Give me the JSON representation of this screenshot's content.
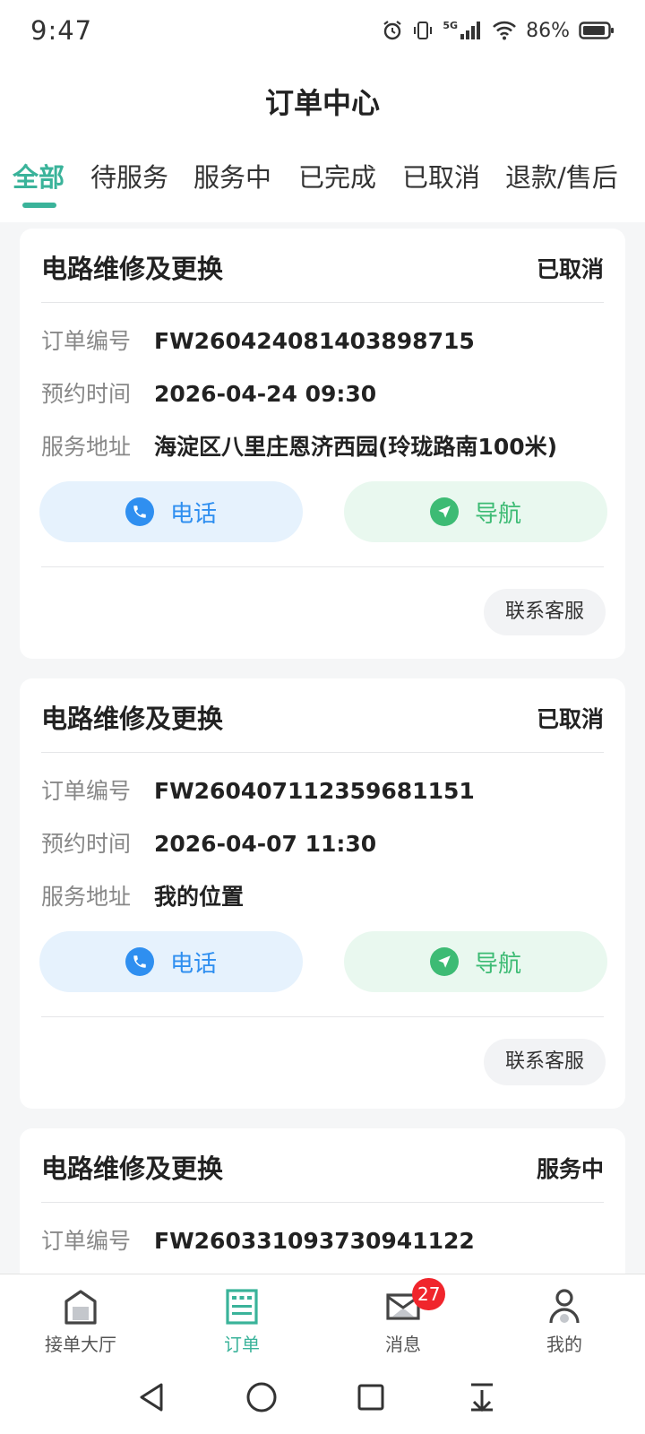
{
  "status_bar": {
    "time": "9:47",
    "network": "5G",
    "battery": "86%",
    "icons": [
      "alarm-icon",
      "vibrate-icon",
      "signal-icon",
      "wifi-icon",
      "battery-icon"
    ]
  },
  "header": {
    "title": "订单中心"
  },
  "tabs": [
    {
      "label": "全部",
      "active": true
    },
    {
      "label": "待服务"
    },
    {
      "label": "服务中"
    },
    {
      "label": "已完成"
    },
    {
      "label": "已取消"
    },
    {
      "label": "退款/售后"
    }
  ],
  "labels": {
    "order_no": "订单编号",
    "appointment_time": "预约时间",
    "service_address": "服务地址",
    "phone": "电话",
    "navigate": "导航",
    "contact_service": "联系客服"
  },
  "orders": [
    {
      "title": "电路维修及更换",
      "status": "已取消",
      "order_no": "FW260424081403898715",
      "time": "2026-04-24 09:30",
      "address": "海淀区八里庄恩济西园(玲珑路南100米)"
    },
    {
      "title": "电路维修及更换",
      "status": "已取消",
      "order_no": "FW260407112359681151",
      "time": "2026-04-07 11:30",
      "address": "我的位置"
    },
    {
      "title": "电路维修及更换",
      "status": "服务中",
      "order_no": "FW260331093730941122"
    }
  ],
  "bottom_nav": [
    {
      "label": "接单大厅",
      "icon": "home-icon"
    },
    {
      "label": "订单",
      "icon": "orders-icon",
      "active": true
    },
    {
      "label": "消息",
      "icon": "mail-icon",
      "badge": "27"
    },
    {
      "label": "我的",
      "icon": "person-icon"
    }
  ],
  "colors": {
    "accent": "#3ab39a",
    "phone_bg": "#e6f2fd",
    "phone_fg": "#2f8ff0",
    "nav_bg": "#e9f8ef",
    "nav_fg": "#3dbb74",
    "badge": "#f0252c"
  }
}
